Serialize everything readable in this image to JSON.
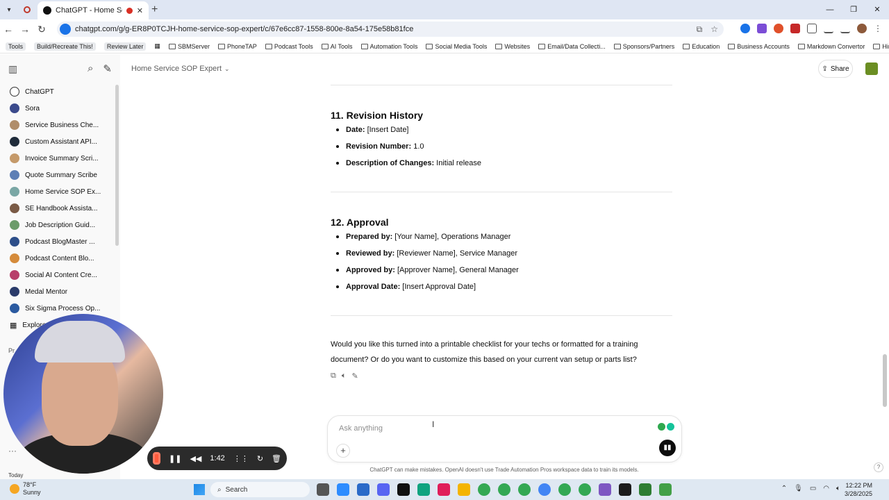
{
  "browser": {
    "tab_title": "ChatGPT - Home Service SC",
    "url": "chatgpt.com/g/g-ER8P0TCJH-home-service-sop-expert/c/67e6cc87-1558-800e-8a54-175e58b81fce",
    "bookmarks": [
      {
        "label": "Tools"
      },
      {
        "label": "Build/Recreate This!"
      },
      {
        "label": "Review Later"
      },
      {
        "label": "SBMServer"
      },
      {
        "label": "PhoneTAP"
      },
      {
        "label": "Podcast Tools"
      },
      {
        "label": "AI Tools"
      },
      {
        "label": "Automation Tools"
      },
      {
        "label": "Social Media Tools"
      },
      {
        "label": "Websites"
      },
      {
        "label": "Email/Data Collecti..."
      },
      {
        "label": "Sponsors/Partners"
      },
      {
        "label": "Education"
      },
      {
        "label": "Business Accounts"
      },
      {
        "label": "Markdown Convertor"
      },
      {
        "label": "Hiring Tools"
      }
    ]
  },
  "sidebar": {
    "items": [
      {
        "label": "ChatGPT",
        "color": "#ffffff"
      },
      {
        "label": "Sora",
        "color": "#3b4a8c"
      },
      {
        "label": "Service Business Che...",
        "color": "#b08d6a"
      },
      {
        "label": "Custom Assistant API...",
        "color": "#1f2b3a"
      },
      {
        "label": "Invoice Summary Scri...",
        "color": "#c59a6a"
      },
      {
        "label": "Quote Summary Scribe",
        "color": "#5e7fb5"
      },
      {
        "label": "Home Service SOP Ex...",
        "color": "#7aa7a5"
      },
      {
        "label": "SE Handbook Assista...",
        "color": "#7a5a45"
      },
      {
        "label": "Job Description Guid...",
        "color": "#6c9b6a"
      },
      {
        "label": "Podcast BlogMaster ...",
        "color": "#2d4f8a"
      },
      {
        "label": "Podcast Content Blo...",
        "color": "#d58b3b"
      },
      {
        "label": "Social AI Content Cre...",
        "color": "#b83f6a"
      },
      {
        "label": "Medal Mentor",
        "color": "#2a3b6a"
      },
      {
        "label": "Six Sigma Process Op...",
        "color": "#2b5aa0"
      }
    ],
    "explore_label": "Explore",
    "section_fragment": "Pr",
    "today_label": "Today"
  },
  "header": {
    "title": "Home Service SOP Expert",
    "share_label": "Share"
  },
  "content": {
    "revision": {
      "heading": "11. Revision History",
      "items": [
        {
          "key": "Date:",
          "value": " [Insert Date]"
        },
        {
          "key": "Revision Number:",
          "value": " 1.0"
        },
        {
          "key": "Description of Changes:",
          "value": " Initial release"
        }
      ]
    },
    "approval": {
      "heading": "12. Approval",
      "items": [
        {
          "key": "Prepared by:",
          "value": " [Your Name], Operations Manager"
        },
        {
          "key": "Reviewed by:",
          "value": " [Reviewer Name], Service Manager"
        },
        {
          "key": "Approved by:",
          "value": " [Approver Name], General Manager"
        },
        {
          "key": "Approval Date:",
          "value": " [Insert Approval Date]"
        }
      ]
    },
    "closing": "Would you like this turned into a printable checklist for your techs or formatted for a training document? Or do you want to customize this based on your current van setup or parts list?"
  },
  "composer": {
    "placeholder": "Ask anything",
    "disclaimer": "ChatGPT can make mistakes. OpenAI doesn't use Trade Automation Pros workspace data to train its models."
  },
  "recording": {
    "time": "1:42"
  },
  "taskbar": {
    "temp": "78°F",
    "condition": "Sunny",
    "search": "Search",
    "time": "12:22 PM",
    "date": "3/28/2025"
  }
}
